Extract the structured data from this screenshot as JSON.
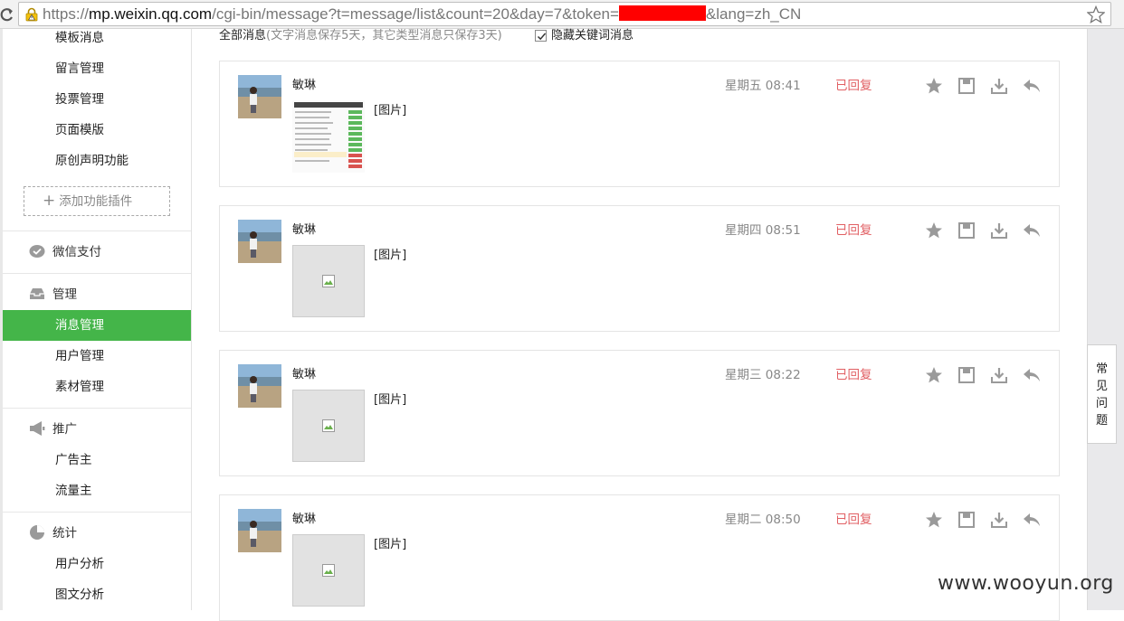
{
  "browser": {
    "url_scheme": "https://",
    "url_host": "mp.weixin.qq.com",
    "url_path": "/cgi-bin/message?t=message/list&count=20&day=7&token=",
    "url_tail": "&lang=zh_CN"
  },
  "sidebar": {
    "top_items": [
      "模板消息",
      "留言管理",
      "投票管理",
      "页面模版",
      "原创声明功能"
    ],
    "add_plugin": "添加功能插件",
    "pay_group": "微信支付",
    "manage_group": "管理",
    "manage_items": [
      "消息管理",
      "用户管理",
      "素材管理"
    ],
    "promo_group": "推广",
    "promo_items": [
      "广告主",
      "流量主"
    ],
    "stats_group": "统计",
    "stats_items": [
      "用户分析",
      "图文分析"
    ]
  },
  "main": {
    "header_title": "全部消息",
    "header_note": "(文字消息保存5天，其它类型消息只保存3天)",
    "hide_keyword_label": "隐藏关键词消息",
    "hide_keyword_checked": true
  },
  "messages": [
    {
      "user": "敏琳",
      "content": "[图片]",
      "time": "星期五 08:41",
      "status": "已回复"
    },
    {
      "user": "敏琳",
      "content": "[图片]",
      "time": "星期四 08:51",
      "status": "已回复"
    },
    {
      "user": "敏琳",
      "content": "[图片]",
      "time": "星期三 08:22",
      "status": "已回复"
    },
    {
      "user": "敏琳",
      "content": "[图片]",
      "time": "星期二 08:50",
      "status": "已回复"
    }
  ],
  "faq_label": [
    "常",
    "见",
    "问",
    "题"
  ],
  "watermark": "www.wooyun.org",
  "colors": {
    "accent_green": "#44b549",
    "replied_red": "#e15f63",
    "redaction": "#ff0000"
  }
}
